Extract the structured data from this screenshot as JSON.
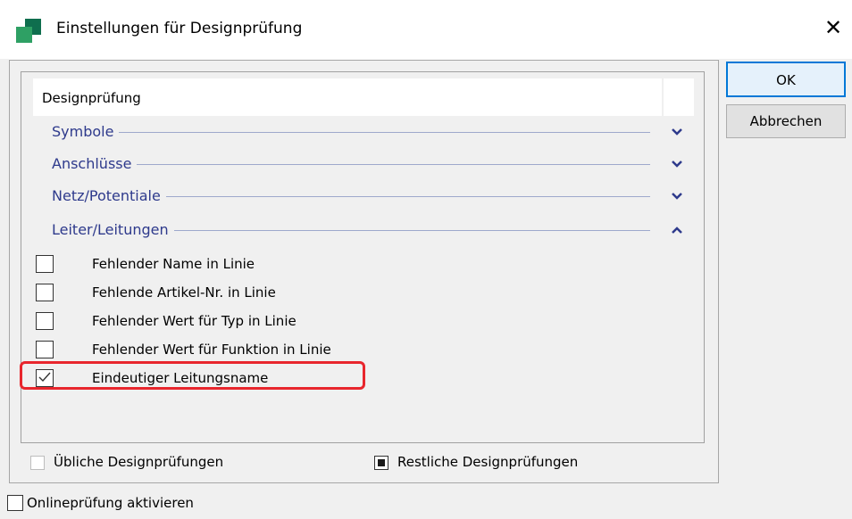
{
  "window": {
    "title": "Einstellungen für Designprüfung",
    "close_glyph": "✕",
    "app_icon": "green-squares-icon"
  },
  "list": {
    "header": "Designprüfung",
    "groups": [
      {
        "label": "Symbole",
        "state": "collapsed"
      },
      {
        "label": "Anschlüsse",
        "state": "collapsed"
      },
      {
        "label": "Netz/Potentiale",
        "state": "collapsed"
      },
      {
        "label": "Leiter/Leitungen",
        "state": "expanded"
      }
    ],
    "items": [
      {
        "label": "Fehlender Name in Linie",
        "checked": false
      },
      {
        "label": "Fehlende Artikel-Nr. in Linie",
        "checked": false
      },
      {
        "label": "Fehlender Wert für Typ in Linie",
        "checked": false
      },
      {
        "label": "Fehlender Wert für Funktion in Linie",
        "checked": false
      },
      {
        "label": "Eindeutiger Leitungsname",
        "checked": true
      }
    ]
  },
  "footer": {
    "common_checks": "Übliche Designprüfungen",
    "remaining_checks": "Restliche Designprüfungen",
    "online_check": "Onlineprüfung aktivieren"
  },
  "buttons": {
    "ok": "OK",
    "cancel": "Abbrechen"
  },
  "colors": {
    "group_text": "#2e3a8c",
    "highlight": "#e8262d",
    "accent": "#0078d7"
  }
}
